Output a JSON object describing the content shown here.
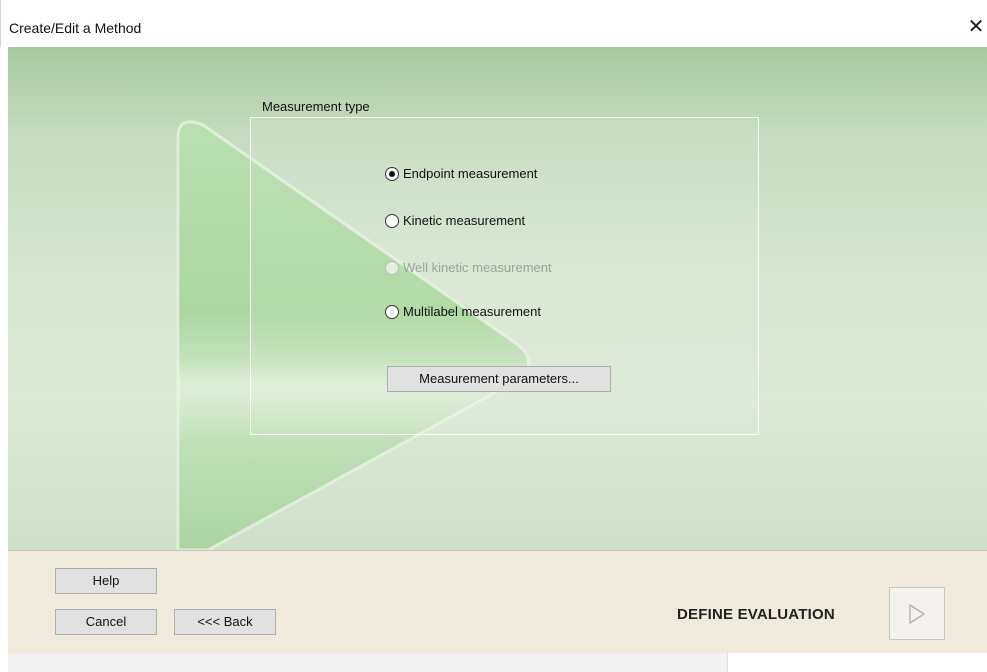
{
  "window": {
    "title": "Create/Edit a Method",
    "close_glyph": "✕"
  },
  "measurement": {
    "group_label": "Measurement type",
    "options": [
      {
        "label": "Endpoint measurement",
        "checked": true,
        "enabled": true
      },
      {
        "label": "Kinetic measurement",
        "checked": false,
        "enabled": true
      },
      {
        "label": "Well kinetic measurement",
        "checked": false,
        "enabled": false
      },
      {
        "label": "Multilabel measurement",
        "checked": false,
        "enabled": true
      }
    ],
    "params_button": "Measurement parameters..."
  },
  "footer": {
    "help_label": "Help",
    "cancel_label": "Cancel",
    "back_label": "<<< Back",
    "next_step_label": "DEFINE EVALUATION",
    "next_icon": "play-arrow-icon"
  },
  "colors": {
    "content_top": "#a8c8a2",
    "content_mid": "#d6e6d1",
    "triangle": "#9fd193",
    "footer_bg": "#efeadb",
    "button_bg": "#e1e1e1"
  }
}
